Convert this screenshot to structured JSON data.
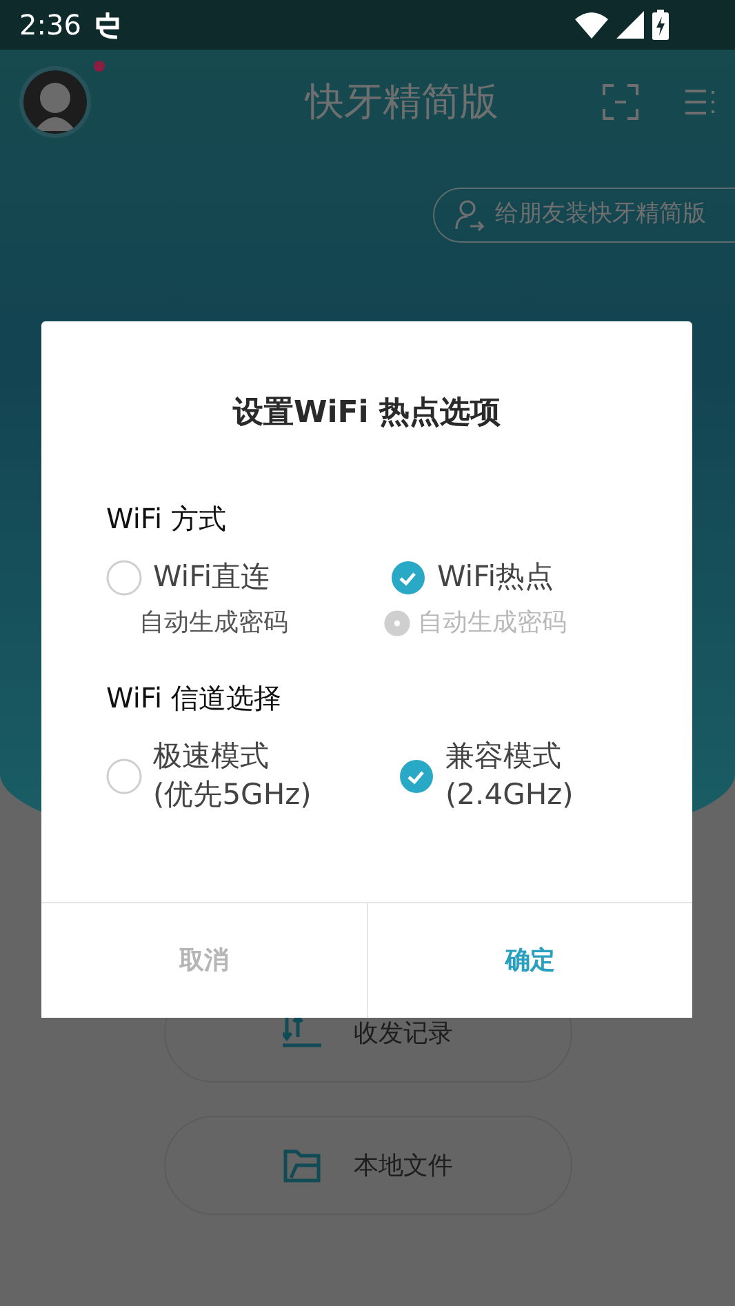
{
  "status_bar": {
    "time": "2:36"
  },
  "header": {
    "title": "快牙精简版",
    "avatar_badge": true
  },
  "invite_button": {
    "label": "给朋友装快牙精简版"
  },
  "menu_buttons": [
    {
      "label": "收发记录",
      "kind": "history"
    },
    {
      "label": "本地文件",
      "kind": "folder"
    }
  ],
  "dialog": {
    "title": "设置WiFi 热点选项",
    "sections": [
      {
        "heading": "WiFi 方式",
        "options": [
          {
            "label": "WiFi直连",
            "selected": false,
            "sub": {
              "label": "自动生成密码",
              "kind": "text",
              "disabled": false
            }
          },
          {
            "label": "WiFi热点",
            "selected": true,
            "sub": {
              "label": "自动生成密码",
              "kind": "radio",
              "disabled": true
            }
          }
        ]
      },
      {
        "heading": "WiFi 信道选择",
        "options": [
          {
            "label": "极速模式",
            "detail": "(优先5GHz)",
            "selected": false
          },
          {
            "label": "兼容模式",
            "detail": "(2.4GHz)",
            "selected": true
          }
        ]
      }
    ],
    "buttons": [
      {
        "label": "取消",
        "kind": "cancel"
      },
      {
        "label": "确定",
        "kind": "confirm"
      }
    ]
  }
}
